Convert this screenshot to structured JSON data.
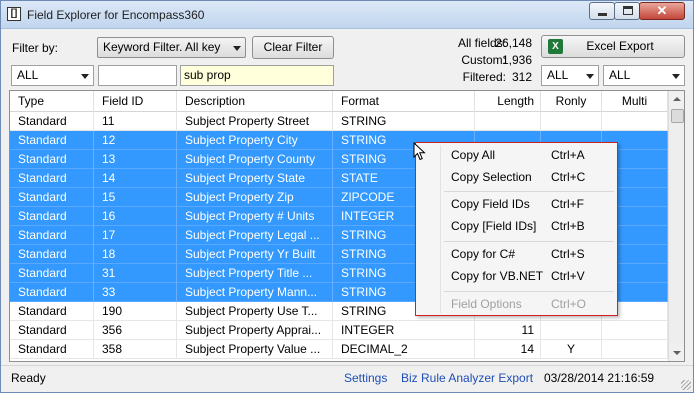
{
  "window": {
    "title": "Field Explorer for Encompass360",
    "icon_glyph": "[]"
  },
  "toolbar": {
    "filter_label": "Filter by:",
    "filter_mode": "Keyword Filter.  All key",
    "clear_button": "Clear Filter",
    "excel_button": "Excel Export",
    "excel_icon_glyph": "X",
    "type_filter": "ALL",
    "id_filter": "",
    "description_filter": "sub prop",
    "rightonly_filter": "ALL",
    "multi_filter": "ALL"
  },
  "stats": {
    "all_label": "All fields:",
    "all_value": "26,148",
    "custom_label": "Custom:",
    "custom_value": "1,936",
    "filtered_label": "Filtered:",
    "filtered_value": "312"
  },
  "grid": {
    "columns": [
      "Type",
      "Field ID",
      "Description",
      "Format",
      "Length",
      "Ronly",
      "Multi"
    ],
    "rows": [
      {
        "type": "Standard",
        "id": "11",
        "desc": "Subject Property Street",
        "format": "STRING",
        "length": "",
        "ronly": "",
        "multi": "",
        "selected": false
      },
      {
        "type": "Standard",
        "id": "12",
        "desc": "Subject Property City",
        "format": "STRING",
        "length": "",
        "ronly": "",
        "multi": "",
        "selected": true
      },
      {
        "type": "Standard",
        "id": "13",
        "desc": "Subject Property County",
        "format": "STRING",
        "length": "",
        "ronly": "",
        "multi": "",
        "selected": true
      },
      {
        "type": "Standard",
        "id": "14",
        "desc": "Subject Property State",
        "format": "STATE",
        "length": "",
        "ronly": "",
        "multi": "",
        "selected": true
      },
      {
        "type": "Standard",
        "id": "15",
        "desc": "Subject Property Zip",
        "format": "ZIPCODE",
        "length": "",
        "ronly": "",
        "multi": "",
        "selected": true
      },
      {
        "type": "Standard",
        "id": "16",
        "desc": "Subject Property # Units",
        "format": "INTEGER",
        "length": "",
        "ronly": "",
        "multi": "",
        "selected": true
      },
      {
        "type": "Standard",
        "id": "17",
        "desc": "Subject Property Legal ...",
        "format": "STRING",
        "length": "",
        "ronly": "",
        "multi": "",
        "selected": true
      },
      {
        "type": "Standard",
        "id": "18",
        "desc": "Subject Property Yr Built",
        "format": "STRING",
        "length": "",
        "ronly": "",
        "multi": "",
        "selected": true
      },
      {
        "type": "Standard",
        "id": "31",
        "desc": "Subject Property Title ...",
        "format": "STRING",
        "length": "",
        "ronly": "",
        "multi": "",
        "selected": true
      },
      {
        "type": "Standard",
        "id": "33",
        "desc": "Subject Property Mann...",
        "format": "STRING",
        "length": "",
        "ronly": "",
        "multi": "",
        "selected": true
      },
      {
        "type": "Standard",
        "id": "190",
        "desc": "Subject Property Use T...",
        "format": "STRING",
        "length": "",
        "ronly": "",
        "multi": "",
        "selected": false
      },
      {
        "type": "Standard",
        "id": "356",
        "desc": "Subject Property Apprai...",
        "format": "INTEGER",
        "length": "11",
        "ronly": "",
        "multi": "",
        "selected": false
      },
      {
        "type": "Standard",
        "id": "358",
        "desc": "Subject Property Value ...",
        "format": "DECIMAL_2",
        "length": "14",
        "ronly": "Y",
        "multi": "",
        "selected": false
      }
    ]
  },
  "context_menu": {
    "items": [
      {
        "label": "Copy All",
        "shortcut": "Ctrl+A",
        "disabled": false
      },
      {
        "label": "Copy Selection",
        "shortcut": "Ctrl+C",
        "disabled": false
      },
      {
        "label": "Copy Field IDs",
        "shortcut": "Ctrl+F",
        "disabled": false
      },
      {
        "label": "Copy [Field IDs]",
        "shortcut": "Ctrl+B",
        "disabled": false
      },
      {
        "label": "Copy for C#",
        "shortcut": "Ctrl+S",
        "disabled": false
      },
      {
        "label": "Copy for VB.NET",
        "shortcut": "Ctrl+V",
        "disabled": false
      },
      {
        "label": "Field Options",
        "shortcut": "Ctrl+O",
        "disabled": true
      }
    ]
  },
  "status": {
    "state": "Ready",
    "settings_link": "Settings",
    "analyzer_link": "Biz Rule Analyzer Export",
    "timestamp": "03/28/2014 21:16:59"
  }
}
